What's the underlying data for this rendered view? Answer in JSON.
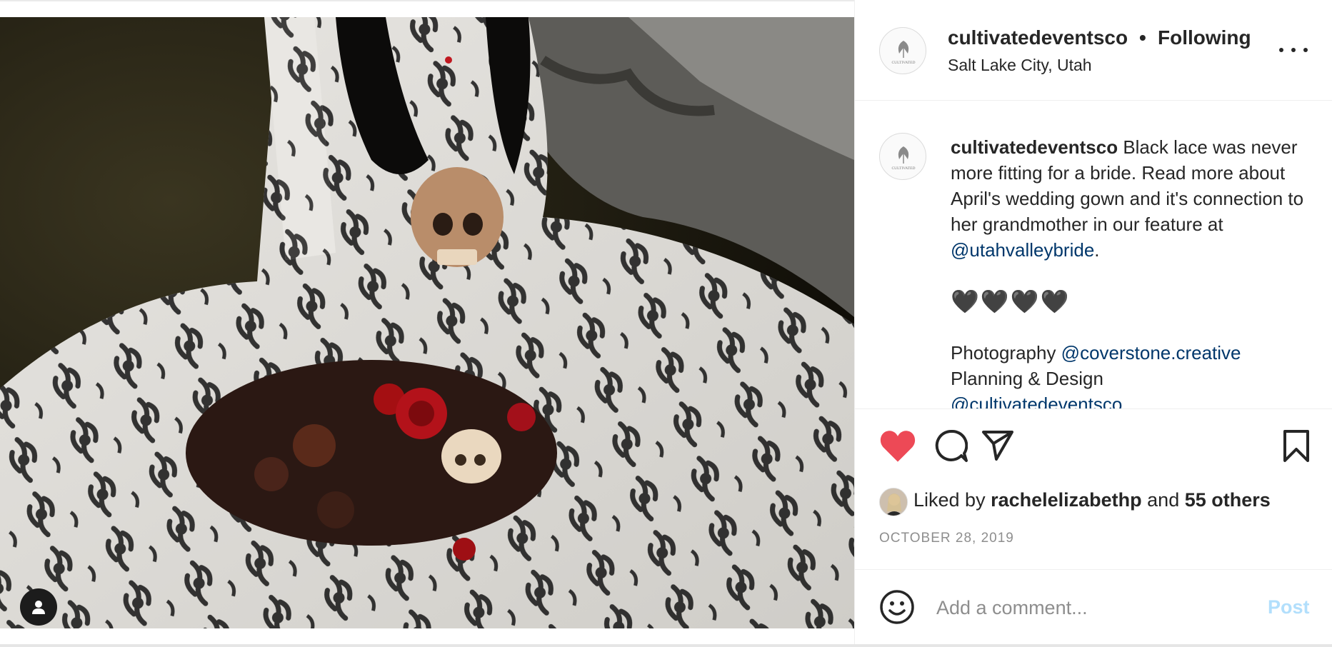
{
  "post": {
    "username": "cultivatedeventsco",
    "separator": "•",
    "follow_status": "Following",
    "location": "Salt Lake City, Utah",
    "avatar_text": "CULTIVATED"
  },
  "caption": {
    "username": "cultivatedeventsco",
    "text_before": " Black lace was never more fitting for a bride. Read more about April's wedding gown and it's connection to her grandmother in our feature at ",
    "mention_1": "@utahvalleybride",
    "text_after": ".",
    "hearts": "🖤🖤🖤🖤",
    "photo_label": "Photography ",
    "mention_2": "@coverstone.creative",
    "planning_label": "Planning & Design",
    "mention_3": "@cultivatedeventsco"
  },
  "actions": {
    "liked_prefix": "Liked by ",
    "liked_user": "rachelelizabethp",
    "liked_middle": " and ",
    "liked_others": "55 others",
    "date": "OCTOBER 28, 2019"
  },
  "comment": {
    "placeholder": "Add a comment...",
    "post_label": "Post"
  },
  "colors": {
    "like_red": "#ed4956",
    "link_blue": "#00376b",
    "post_disabled": "#b2dffc"
  }
}
